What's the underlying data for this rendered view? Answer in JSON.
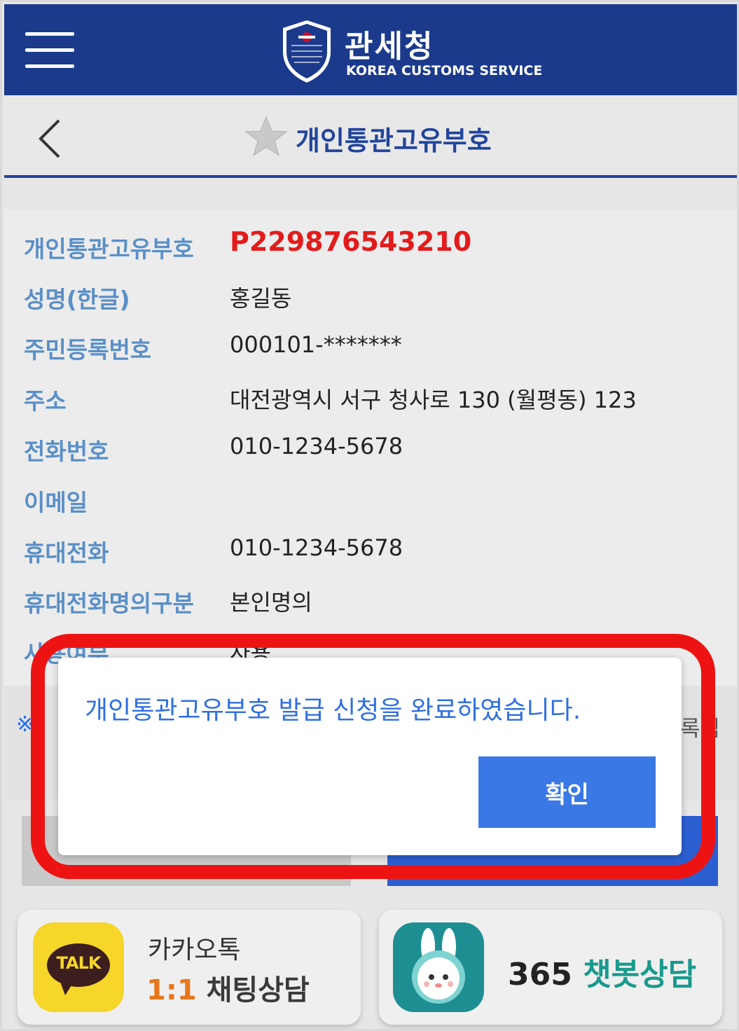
{
  "header": {
    "brand_ko": "관세청",
    "brand_en": "KOREA CUSTOMS SERVICE",
    "logo_text": "관세청 KOREA CUSTOMS SERVICE"
  },
  "titlebar": {
    "title": "개인통관고유부호"
  },
  "info": {
    "rows": [
      {
        "label": "개인통관고유부호",
        "value": "P229876543210"
      },
      {
        "label": "성명(한글)",
        "value": "홍길동"
      },
      {
        "label": "주민등록번호",
        "value": "000101-*******"
      },
      {
        "label": "주소",
        "value": "대전광역시 서구 청사로 130 (월평동) 123"
      },
      {
        "label": "전화번호",
        "value": "010-1234-5678"
      },
      {
        "label": "이메일",
        "value": ""
      },
      {
        "label": "휴대전화",
        "value": "010-1234-5678"
      },
      {
        "label": "휴대전화명의구분",
        "value": "본인명의"
      },
      {
        "label": "사용여부",
        "value": "사용"
      }
    ],
    "note_mark": "※",
    "note_right": "록팁"
  },
  "dialog": {
    "message": "개인통관고유부호 발급 신청을 완료하였습니다.",
    "ok_label": "확인"
  },
  "cards": {
    "kakao": {
      "icon_text": "TALK",
      "line1": "카카오톡",
      "line2_num": "1:1",
      "line2_txt": "채팅상담"
    },
    "chatbot": {
      "num": "365",
      "txt": "챗봇상담"
    }
  },
  "colors": {
    "header_bg": "#1b3a8c",
    "accent_blue": "#22459c",
    "label_blue": "#5a8fc7",
    "code_red": "#e41b1b",
    "highlight_red": "#ee1313",
    "dialog_button": "#3a78e6"
  }
}
